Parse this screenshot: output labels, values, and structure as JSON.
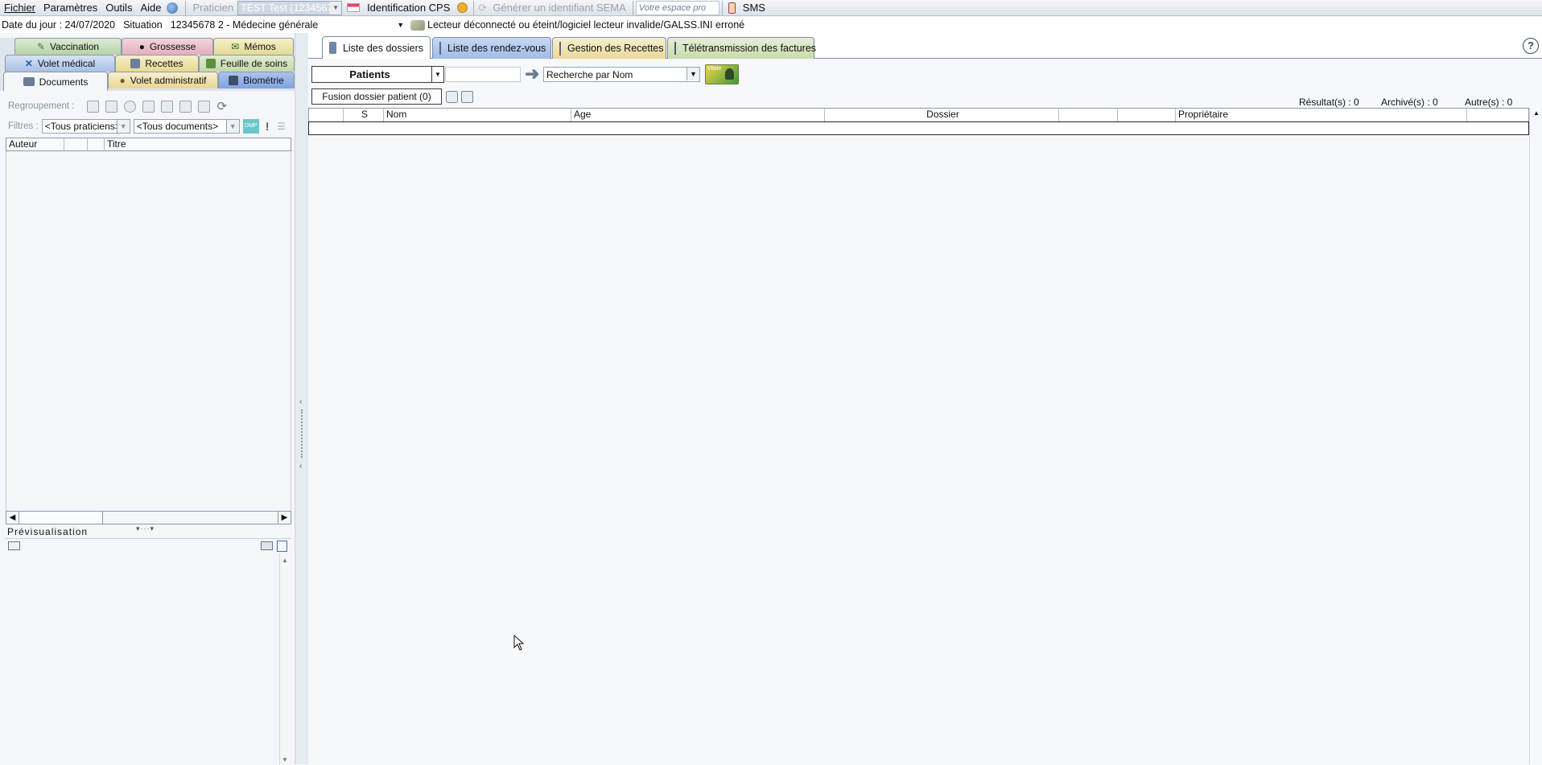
{
  "menu": {
    "fichier": "Fichier",
    "parametres": "Paramètres",
    "outils": "Outils",
    "aide": "Aide",
    "praticien_label": "Praticien",
    "praticien_value": "TEST Test (123456782",
    "identification": "Identification CPS",
    "generer": "Générer un identifiant SEMA",
    "espace_pro": "Votre espace pro",
    "sms": "SMS"
  },
  "status": {
    "date": "Date du jour : 24/07/2020",
    "situation_label": "Situation",
    "situation_value": "12345678 2 - Médecine générale",
    "lecteur": "Lecteur déconnecté ou éteint/logiciel lecteur invalide/GALSS.INI erroné"
  },
  "left_tabs": {
    "row1": [
      "Vaccination",
      "Grossesse",
      "Mémos"
    ],
    "row2": [
      "Volet médical",
      "Recettes",
      "Feuille de soins"
    ],
    "row3": [
      "Documents",
      "Volet administratif",
      "Biométrie"
    ]
  },
  "left": {
    "regroupement": "Regroupement :",
    "filtres": "Filtres :",
    "praticiens": "<Tous praticiens>",
    "documents": "<Tous documents>",
    "dmp": "DMP",
    "columns": [
      "Auteur",
      "",
      "",
      "Titre"
    ],
    "preview": "Prévisualisation"
  },
  "main_tabs": [
    "Liste des dossiers",
    "Liste des rendez-vous",
    "Gestion des Recettes",
    "Télétransmission des factures"
  ],
  "help": "?",
  "search": {
    "type": "Patients",
    "mode": "Recherche par Nom",
    "vitale": "Vitale",
    "fusion": "Fusion dossier patient (0)"
  },
  "counts": {
    "resultats": "Résultat(s) : 0",
    "archives": "Archivé(s) : 0",
    "autres": "Autre(s) : 0"
  },
  "grid": {
    "columns": [
      "",
      "S",
      "Nom",
      "Age",
      "Dossier",
      "",
      "",
      "Propriétaire",
      ""
    ]
  }
}
